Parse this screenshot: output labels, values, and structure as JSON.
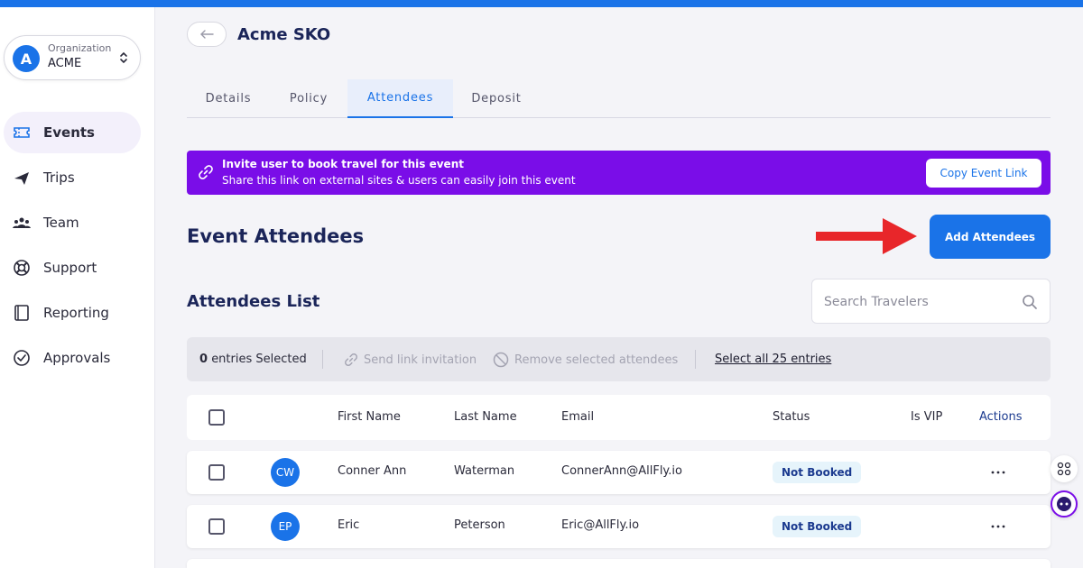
{
  "org": {
    "initial": "A",
    "caption": "Organization",
    "name": "ACME"
  },
  "nav": [
    {
      "label": "Events",
      "icon": "ticket-icon",
      "active": true
    },
    {
      "label": "Trips",
      "icon": "airplane-icon"
    },
    {
      "label": "Team",
      "icon": "team-icon"
    },
    {
      "label": "Support",
      "icon": "lifebuoy-icon"
    },
    {
      "label": "Reporting",
      "icon": "report-icon"
    },
    {
      "label": "Approvals",
      "icon": "check-circle-icon"
    }
  ],
  "page": {
    "title": "Acme SKO"
  },
  "tabs": [
    {
      "label": "Details"
    },
    {
      "label": "Policy"
    },
    {
      "label": "Attendees",
      "active": true
    },
    {
      "label": "Deposit"
    }
  ],
  "banner": {
    "title": "Invite user to book travel for this event",
    "subtitle": "Share this link on external sites & users can easily join this event",
    "button": "Copy Event Link"
  },
  "event_attendees": {
    "title": "Event Attendees",
    "add_button": "Add Attendees"
  },
  "attendees_list": {
    "title": "Attendees List",
    "search_placeholder": "Search Travelers"
  },
  "bulk": {
    "count": "0",
    "count_suffix": "entries Selected",
    "send_link": "Send link invitation",
    "remove": "Remove selected attendees",
    "select_all": "Select all 25 entries"
  },
  "table": {
    "headers": {
      "first_name": "First Name",
      "last_name": "Last Name",
      "email": "Email",
      "status": "Status",
      "is_vip": "Is VIP",
      "actions": "Actions"
    },
    "rows": [
      {
        "initials": "CW",
        "first_name": "Conner Ann",
        "last_name": "Waterman",
        "email": "ConnerAnn@AllFly.io",
        "status": "Not Booked"
      },
      {
        "initials": "EP",
        "first_name": "Eric",
        "last_name": "Peterson",
        "email": "Eric@AllFly.io",
        "status": "Not Booked"
      }
    ]
  },
  "colors": {
    "brand_blue": "#1a73e8",
    "banner_purple": "#7a0de8",
    "title_navy": "#1b2559",
    "arrow_red": "#e8262a",
    "status_bg": "#e6f4fb"
  }
}
